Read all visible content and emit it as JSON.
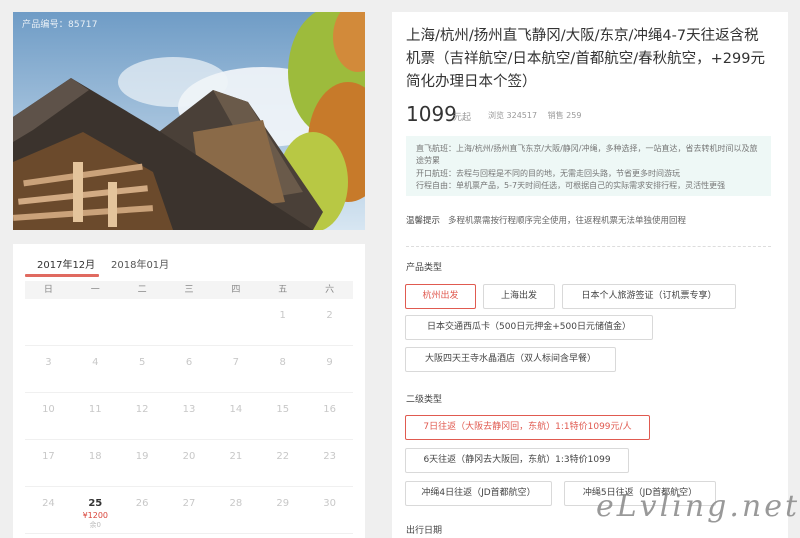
{
  "hero": {
    "product_no": "产品编号：85717"
  },
  "calendar": {
    "tabs": [
      "2017年12月",
      "2018年01月"
    ],
    "weekdays": [
      "日",
      "一",
      "二",
      "三",
      "四",
      "五",
      "六"
    ],
    "rows": [
      [
        "",
        "",
        "",
        "",
        "",
        "1",
        "2"
      ],
      [
        "3",
        "4",
        "5",
        "6",
        "7",
        "8",
        "9"
      ],
      [
        "10",
        "11",
        "12",
        "13",
        "14",
        "15",
        "16"
      ],
      [
        "17",
        "18",
        "19",
        "20",
        "21",
        "22",
        "23"
      ],
      [
        "24",
        "25",
        "26",
        "27",
        "28",
        "29",
        "30"
      ]
    ],
    "available_day": {
      "day": "25",
      "price": "¥1200",
      "remain": "余0"
    }
  },
  "product": {
    "title": "上海/杭州/扬州直飞静冈/大阪/东京/冲绳4-7天往返含税机票（吉祥航空/日本航空/首都航空/春秋航空，+299元简化办理日本个签）",
    "price": "1099",
    "price_unit": "元起",
    "views": "浏览 324517",
    "sales": "销售 259",
    "info": [
      "直飞航班：上海/杭州/扬州直飞东京/大阪/静冈/冲绳，多种选择，一站直达，省去转机时间以及旅途劳累",
      "开口航班：去程与回程是不同的目的地，无需走回头路，节省更多时间游玩",
      "行程自由：单机票产品，5-7天时间任选，可根据自己的实际需求安排行程，灵活性更强"
    ],
    "tip_label": "温馨提示",
    "tip_text": "多程机票需按行程顺序完全使用，往返程机票无法单独使用回程"
  },
  "options": {
    "type_label": "产品类型",
    "types": [
      "杭州出发",
      "上海出发",
      "日本个人旅游签证（订机票专享）",
      "日本交通西瓜卡（500日元押金+500日元储值金）",
      "大阪四天王寺水晶酒店（双人标间含早餐）"
    ],
    "sub_label": "二级类型",
    "subs": [
      "7日往返（大阪去静冈回，东航）1:1特价1099元/人",
      "6天往返（静冈去大阪回，东航）1:3特价1099",
      "冲绳4日往返（JD首都航空）",
      "冲绳5日往返（JD首都航空）"
    ],
    "date_label": "出行日期"
  },
  "watermark": "eLvling.net",
  "colors": {
    "accent": "#e05a50",
    "price_red": "#d9453b",
    "info_bg": "#eef8f6"
  }
}
